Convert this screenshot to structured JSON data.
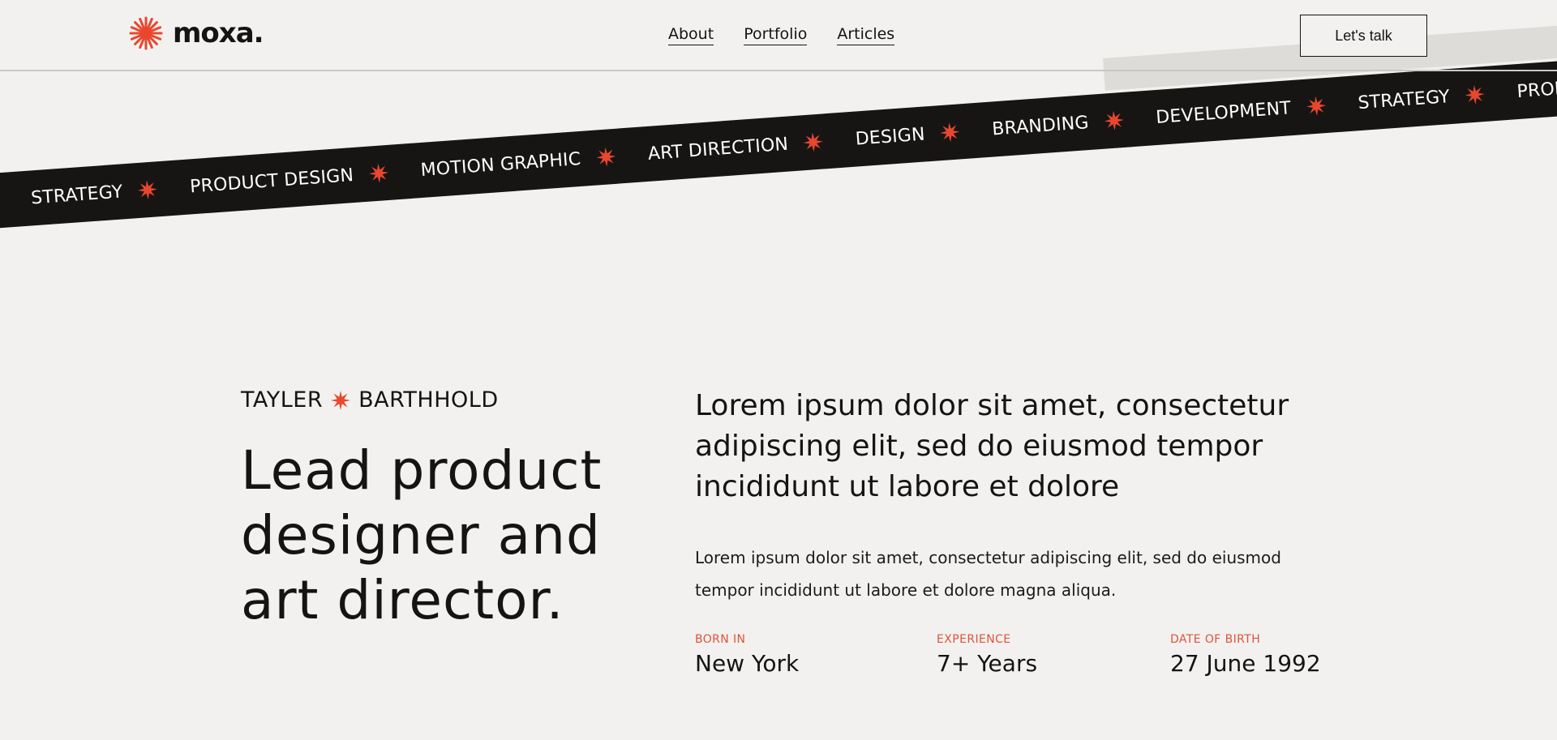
{
  "brand": {
    "name": "moxa.",
    "accent_color": "#e8472e",
    "dark_color": "#171513",
    "background_color": "#f2f1ef"
  },
  "nav": {
    "items": [
      {
        "label": "About"
      },
      {
        "label": "Portfolio"
      },
      {
        "label": "Articles"
      }
    ],
    "cta_label": "Let's talk"
  },
  "marquee": {
    "items": [
      {
        "label": "STRATEGY"
      },
      {
        "label": "PRODUCT DESIGN"
      },
      {
        "label": "MOTION GRAPHIC"
      },
      {
        "label": "ART DIRECTION"
      },
      {
        "label": "DESIGN"
      },
      {
        "label": "BRANDING"
      },
      {
        "label": "DEVELOPMENT"
      },
      {
        "label": "STRATEGY"
      },
      {
        "label": "PRODUCT DESIGN"
      }
    ],
    "separator_icon": "starburst-icon"
  },
  "hero": {
    "first_name": "TAYLER",
    "last_name": "BARTHHOLD",
    "headline": "Lead product designer and art director.",
    "lead": "Lorem ipsum dolor sit amet, consectetur adipiscing elit, sed do eiusmod tempor incididunt ut labore et dolore",
    "body": "Lorem ipsum dolor sit amet, consectetur adipiscing elit, sed do eiusmod tempor incididunt ut labore et dolore magna aliqua.",
    "facts": [
      {
        "label": "BORN IN",
        "value": "New York"
      },
      {
        "label": "EXPERIENCE",
        "value": "7+ Years"
      },
      {
        "label": "DATE OF BIRTH",
        "value": "27 June 1992"
      }
    ]
  }
}
